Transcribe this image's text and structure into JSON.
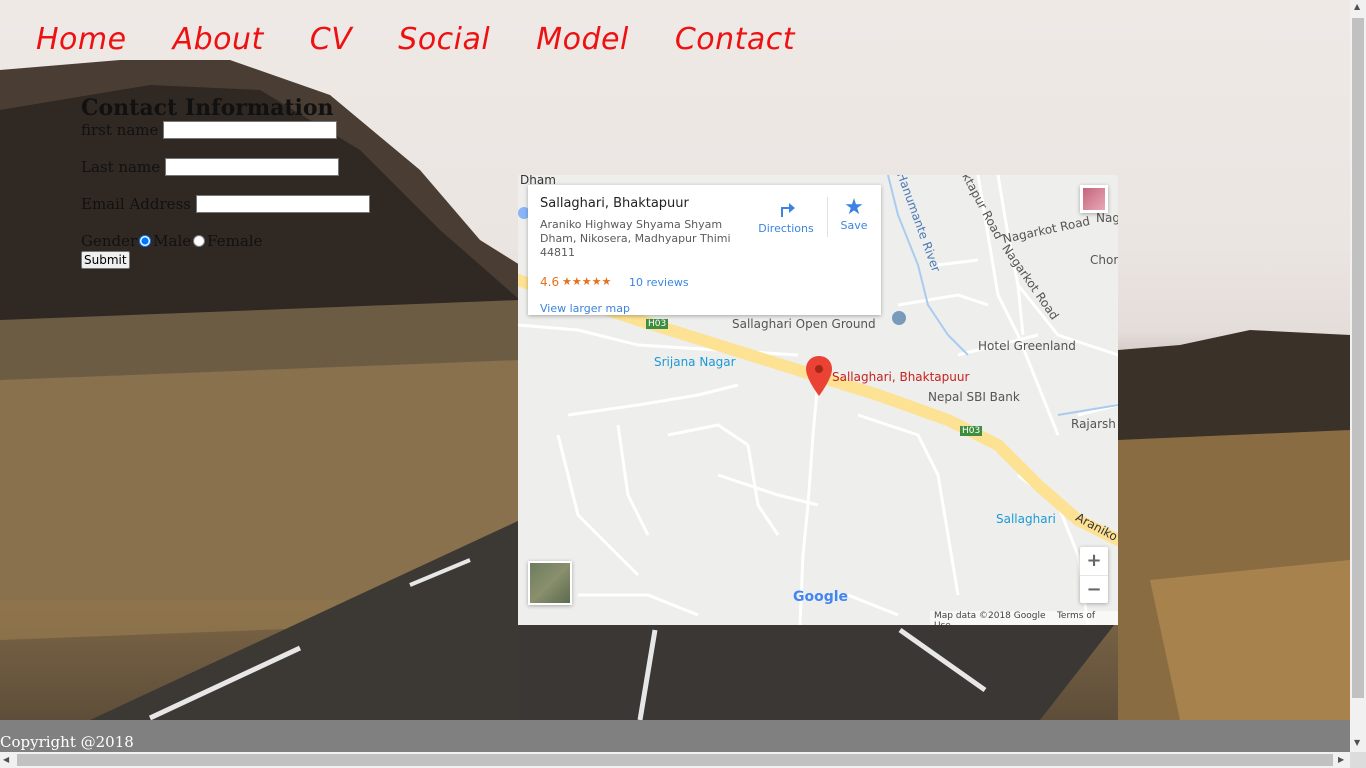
{
  "nav": {
    "items": [
      "Home",
      "About",
      "CV",
      "Social",
      "Model",
      "Contact"
    ]
  },
  "form": {
    "heading": "Contact Information",
    "first_name_label": "first name",
    "last_name_label": "Last name",
    "email_label": "Email Address",
    "gender_label": "Gender",
    "male_label": "Male",
    "female_label": "Female",
    "submit_label": "Submit"
  },
  "map": {
    "place_name": "Sallaghari, Bhaktapuur",
    "address": "Araniko Highway Shyama Shyam Dham, Nikosera, Madhyapur Thimi 44811",
    "rating": "4.6",
    "stars": "★★★★★",
    "reviews": "10 reviews",
    "larger_map": "View larger map",
    "directions": "Directions",
    "save": "Save",
    "labels": {
      "dham": "Dham",
      "open_ground": "Sallaghari Open Ground",
      "srijana": "Srijana Nagar",
      "pin_label": "Sallaghari, Bhaktapuur",
      "hotel": "Hotel Greenland",
      "sbi": "Nepal SBI Bank",
      "rajarsh": "Rajarsh",
      "sallaghari": "Sallaghari",
      "araniko": "Araniko",
      "nagarkot_road_1": "Nagarkot Road",
      "nagarkot_road_2": "Nagarkot Road",
      "hanumante": "Hanumante River",
      "ktapur": "ktapur Road",
      "chor": "Chor",
      "nag": "Nag",
      "h03_1": "H03",
      "h03_2": "H03",
      "google": "Google"
    },
    "zoom_in": "+",
    "zoom_out": "−",
    "attribution": "Map data ©2018 Google",
    "terms": "Terms of Use"
  },
  "footer": {
    "copyright": "Copyright @2018"
  }
}
